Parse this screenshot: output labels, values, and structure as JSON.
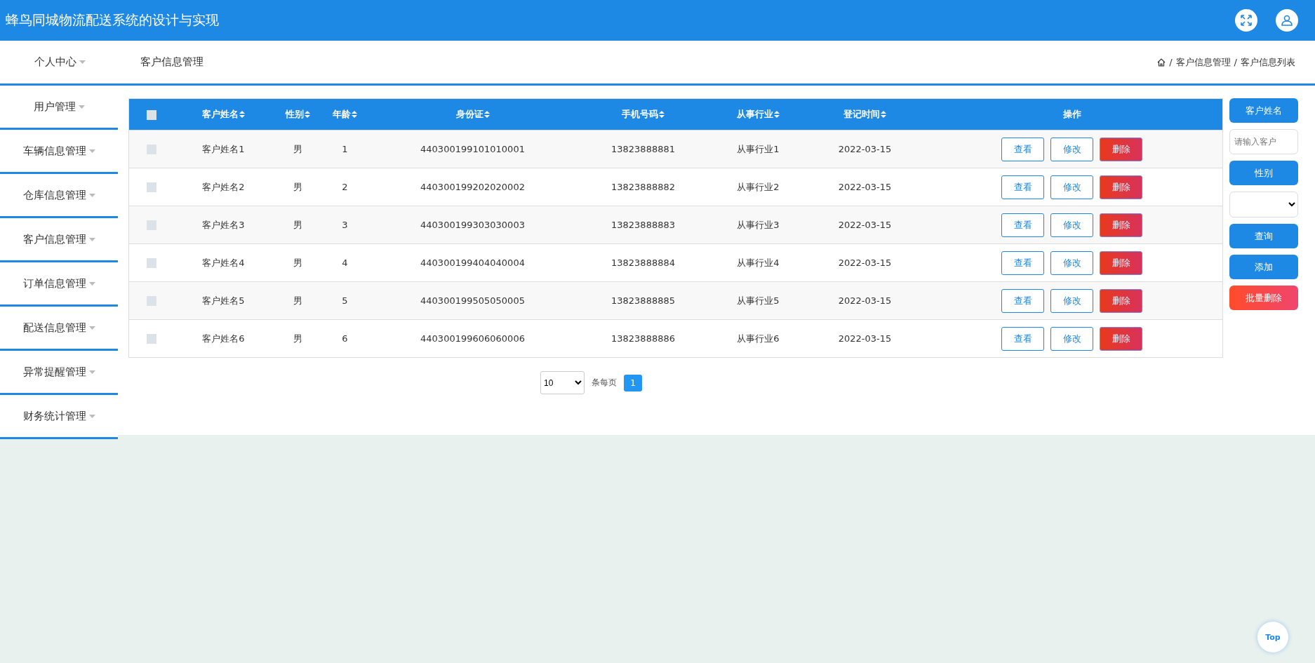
{
  "header": {
    "title": "蜂鸟同城物流配送系统的设计与实现"
  },
  "top_nav": {
    "menu_label": "个人中心",
    "page_title": "客户信息管理",
    "breadcrumb": [
      {
        "separator": "/",
        "label": "客户信息管理"
      },
      {
        "separator": "/",
        "label": "客户信息列表"
      }
    ]
  },
  "sidebar": {
    "items": [
      {
        "label": "用户管理"
      },
      {
        "label": "车辆信息管理"
      },
      {
        "label": "仓库信息管理"
      },
      {
        "label": "客户信息管理"
      },
      {
        "label": "订单信息管理"
      },
      {
        "label": "配送信息管理"
      },
      {
        "label": "异常提醒管理"
      },
      {
        "label": "财务统计管理"
      }
    ]
  },
  "table": {
    "select_all_checked": false,
    "columns": [
      {
        "label": "客户姓名",
        "sortable": true
      },
      {
        "label": "性别",
        "sortable": true
      },
      {
        "label": "年龄",
        "sortable": true
      },
      {
        "label": "身份证",
        "sortable": true
      },
      {
        "label": "手机号码",
        "sortable": true
      },
      {
        "label": "从事行业",
        "sortable": true
      },
      {
        "label": "登记时间",
        "sortable": true
      },
      {
        "label": "操作",
        "sortable": false
      }
    ],
    "rows": [
      {
        "checked": false,
        "cells": [
          "客户姓名1",
          "男",
          "1",
          "440300199101010001",
          "13823888881",
          "从事行业1",
          "2022-03-15"
        ],
        "actions": [
          {
            "label": "查看",
            "kind": "outline"
          },
          {
            "label": "修改",
            "kind": "outline"
          },
          {
            "label": "删除",
            "kind": "danger"
          }
        ]
      },
      {
        "checked": false,
        "cells": [
          "客户姓名2",
          "男",
          "2",
          "440300199202020002",
          "13823888882",
          "从事行业2",
          "2022-03-15"
        ],
        "actions": [
          {
            "label": "查看",
            "kind": "outline"
          },
          {
            "label": "修改",
            "kind": "outline"
          },
          {
            "label": "删除",
            "kind": "danger"
          }
        ]
      },
      {
        "checked": false,
        "cells": [
          "客户姓名3",
          "男",
          "3",
          "440300199303030003",
          "13823888883",
          "从事行业3",
          "2022-03-15"
        ],
        "actions": [
          {
            "label": "查看",
            "kind": "outline"
          },
          {
            "label": "修改",
            "kind": "outline"
          },
          {
            "label": "删除",
            "kind": "danger"
          }
        ]
      },
      {
        "checked": false,
        "cells": [
          "客户姓名4",
          "男",
          "4",
          "440300199404040004",
          "13823888884",
          "从事行业4",
          "2022-03-15"
        ],
        "actions": [
          {
            "label": "查看",
            "kind": "outline"
          },
          {
            "label": "修改",
            "kind": "outline"
          },
          {
            "label": "删除",
            "kind": "danger"
          }
        ]
      },
      {
        "checked": false,
        "cells": [
          "客户姓名5",
          "男",
          "5",
          "440300199505050005",
          "13823888885",
          "从事行业5",
          "2022-03-15"
        ],
        "actions": [
          {
            "label": "查看",
            "kind": "outline"
          },
          {
            "label": "修改",
            "kind": "outline"
          },
          {
            "label": "删除",
            "kind": "danger"
          }
        ]
      },
      {
        "checked": false,
        "cells": [
          "客户姓名6",
          "男",
          "6",
          "440300199606060006",
          "13823888886",
          "从事行业6",
          "2022-03-15"
        ],
        "actions": [
          {
            "label": "查看",
            "kind": "outline"
          },
          {
            "label": "修改",
            "kind": "outline"
          },
          {
            "label": "删除",
            "kind": "danger"
          }
        ]
      }
    ]
  },
  "search_panel": [
    {
      "kind": "label",
      "label": "客户姓名"
    },
    {
      "kind": "input",
      "placeholder": "请输入客户"
    },
    {
      "kind": "label",
      "label": "性别"
    },
    {
      "kind": "select"
    },
    {
      "kind": "button",
      "label": "查询"
    },
    {
      "kind": "button",
      "label": "添加"
    },
    {
      "kind": "danger_button",
      "label": "批量删除"
    }
  ],
  "pagination": {
    "page_size": "10",
    "per_page_label": "条每页",
    "pages": [
      {
        "label": "1",
        "selected": true
      }
    ]
  },
  "back_to_top": {
    "label": "Top"
  }
}
